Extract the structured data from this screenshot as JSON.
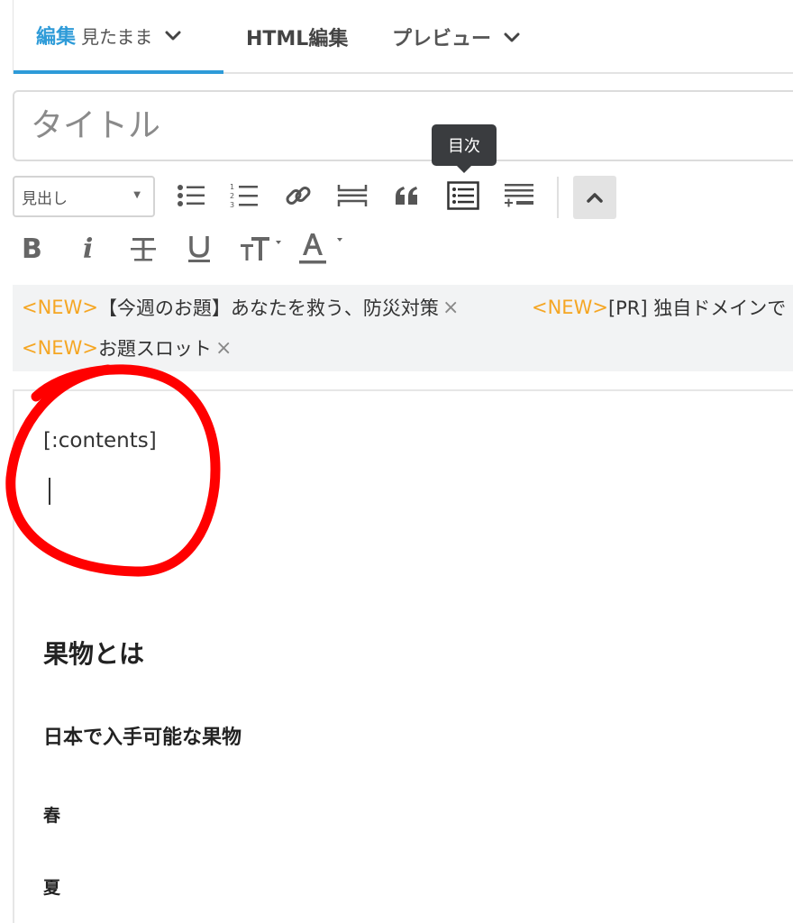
{
  "tabs": {
    "edit_label": "編集",
    "edit_mode": "見たまま",
    "html_label": "HTML編集",
    "preview_label": "プレビュー"
  },
  "title_input": {
    "placeholder": "タイトル",
    "value": ""
  },
  "toolbar": {
    "heading_select": "見出し",
    "tooltip": "目次",
    "icons": [
      "bulleted-list-icon",
      "numbered-list-icon",
      "link-icon",
      "read-more-icon",
      "quote-icon",
      "table-of-contents-icon",
      "footnote-icon",
      "collapse-up-icon"
    ],
    "format_icons": [
      "bold-icon",
      "italic-icon",
      "strikethrough-icon",
      "underline-icon",
      "font-size-icon",
      "text-color-icon"
    ]
  },
  "format": {
    "bold": "B",
    "italic": "i",
    "size": "T",
    "color": "A"
  },
  "suggestions": [
    {
      "tag": "<NEW>",
      "text": "【今週のお題】あなたを救う、防災対策",
      "close": "×"
    },
    {
      "tag": "<NEW>",
      "text": "[PR] 独自ドメインで",
      "close": ""
    },
    {
      "tag": "<NEW>",
      "text": "お題スロット",
      "close": "×"
    }
  ],
  "editor": {
    "contents_tag": "[:contents]",
    "h1": "果物とは",
    "h2": "日本で入手可能な果物",
    "h3_spring": "春",
    "h3_summer": "夏"
  },
  "colors": {
    "accent": "#2e9bd8",
    "new_tag": "#f5a623",
    "annotation": "#ff0000",
    "tooltip_bg": "#3a3c3f"
  }
}
